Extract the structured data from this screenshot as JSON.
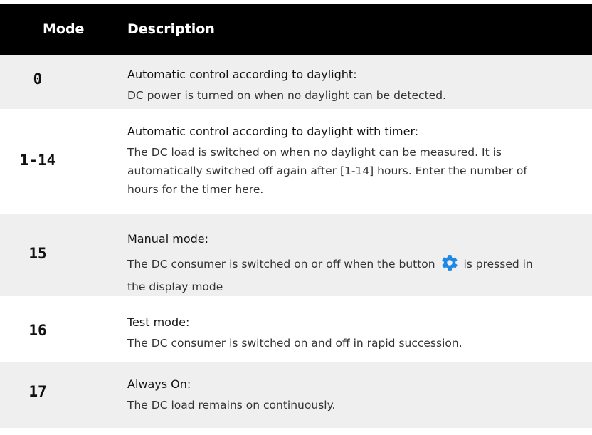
{
  "header": {
    "mode": "Mode",
    "description": "Description"
  },
  "rows": [
    {
      "mode": "0",
      "title": "Automatic control according to daylight:",
      "body": "DC power is turned on when no daylight can be detected."
    },
    {
      "mode": "1-14",
      "title": "Automatic control according to daylight with timer:",
      "body": "The DC load is switched on when no daylight can be measured. It is automatically switched off again after [1-14] hours. Enter the number of hours for the timer here."
    },
    {
      "mode": "15",
      "title": "Manual mode:",
      "body_before": "The DC consumer is switched on or off when the button",
      "body_icon": "gear-icon",
      "body_after": "is pressed in the display mode"
    },
    {
      "mode": "16",
      "title": "Test mode:",
      "body": "The DC consumer is switched on and off in rapid succession."
    },
    {
      "mode": "17",
      "title": "Always On:",
      "body": "The DC load remains on continuously."
    }
  ],
  "colors": {
    "header_bg": "#000000",
    "row_shade": "#efefef",
    "gear_icon": "#1e88e5"
  }
}
